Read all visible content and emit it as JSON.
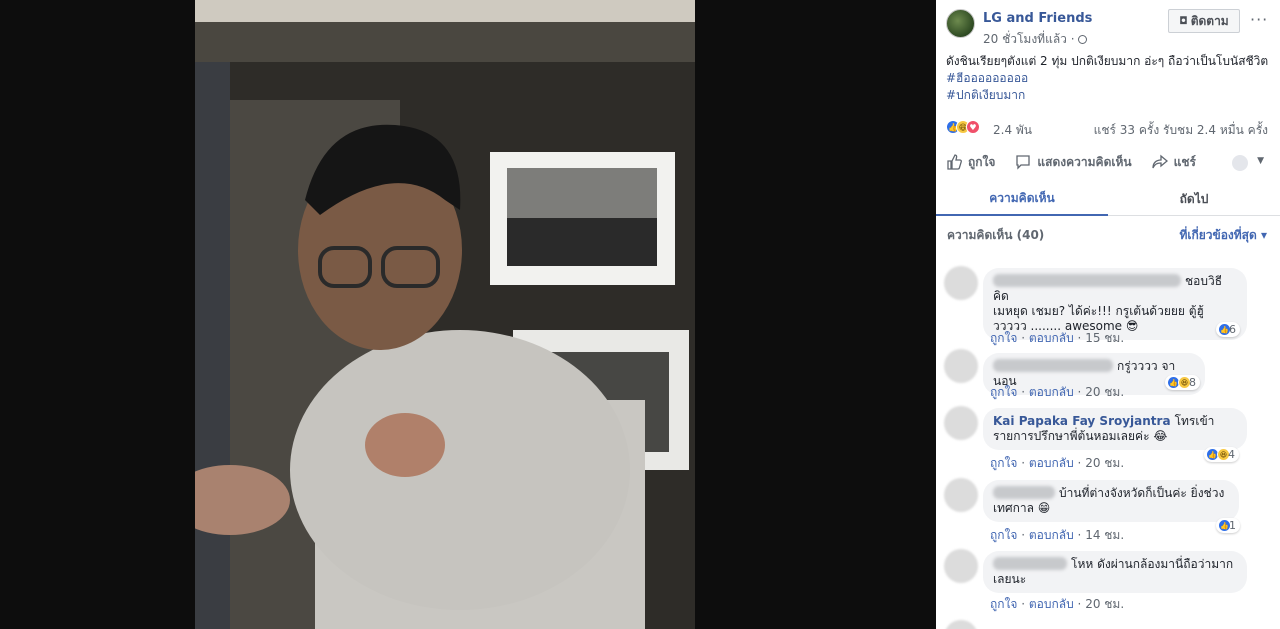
{
  "post": {
    "page_name": "LG and Friends",
    "time": "20 ชั่วโมงที่แล้ว ·",
    "follow_label": "ติดตาม",
    "more_label": "···",
    "caption": "ดังชินเรียยๆตังแต่ 2 ทุ่ม ปกติเงียบมาก อ่ะๆ ถือว่าเป็นโบนัสชีวิต",
    "hashtags": [
      "#ฮีอออออออออ",
      "#ปกติเงียบมาก"
    ]
  },
  "reactions": {
    "count": "2.4 พัน",
    "stats": "แชร์ 33 ครั้ง  รับชม 2.4 หมื่น ครั้ง"
  },
  "actions": {
    "like": "ถูกใจ",
    "comment": "แสดงความคิดเห็น",
    "share": "แชร์"
  },
  "tabs": [
    "ความคิดเห็น",
    "ถัดไป"
  ],
  "comments_header": {
    "count": "ความคิดเห็น (40)",
    "sort": "ที่เกี่ยวข้องที่สุด"
  },
  "comments": [
    {
      "name": "",
      "text_line1": "ชอบวิธีคิด",
      "text_rest": "เมหยุด เชมย? ได้ค่ะ!!! กรูเต้นด้วยยย ตู้ฮู้ ววววว ........ awesome 😎",
      "reacts": "6",
      "like": "ถูกใจ",
      "reply": "ตอบกลับ",
      "time": "15 ชม."
    },
    {
      "name": "",
      "text_line1": "กรู่วววว จานอน",
      "text_rest": "",
      "reacts": "8",
      "like": "ถูกใจ",
      "reply": "ตอบกลับ",
      "time": "20 ชม."
    },
    {
      "name": "Kai Papaka Fay Sroyjantra",
      "text_line1": "โทรเข้า",
      "text_rest": "รายการปรึกษาพี่ต้นหอมเลยค่ะ 😂",
      "reacts": "4",
      "like": "ถูกใจ",
      "reply": "ตอบกลับ",
      "time": "20 ชม."
    },
    {
      "name": "",
      "text_line1": "บ้านที่ต่างจังหวัดก็เป็นค่ะ ยิ่งช่วง",
      "text_rest": "เทศกาล 😁",
      "reacts": "1",
      "like": "ถูกใจ",
      "reply": "ตอบกลับ",
      "time": "14 ชม."
    },
    {
      "name": "",
      "text_line1": "โหห ดังผ่านกล้องมานี่ถือว่ามาก",
      "text_rest": "เลยนะ",
      "reacts": "",
      "like": "ถูกใจ",
      "reply": "ตอบกลับ",
      "time": "20 ชม."
    }
  ],
  "colors": {
    "link": "#385898",
    "accent": "#4267b2",
    "like_blue": "#2f6fe8"
  }
}
